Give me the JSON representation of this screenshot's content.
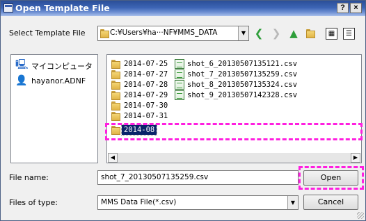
{
  "window": {
    "title": "Open Template File",
    "help_button": "?",
    "close_button": "×"
  },
  "toolbar": {
    "look_in_label": "Select Template File",
    "path": "C:¥Users¥ha···NF¥MMS_DATA"
  },
  "places": [
    {
      "label": "マイコンピュータ",
      "icon": "my-computer-icon"
    },
    {
      "label": "hayanor.ADNF",
      "icon": "user-folder-icon"
    }
  ],
  "folders": [
    "2014-07-25",
    "2014-07-27",
    "2014-07-28",
    "2014-07-29",
    "2014-07-30",
    "2014-07-31",
    "2014-08"
  ],
  "files": [
    "shot_6_20130507135121.csv",
    "shot_7_20130507135259.csv",
    "shot_8_20130507135324.csv",
    "shot_9_20130507142328.csv"
  ],
  "selected_folder": "2014-08",
  "form": {
    "file_name_label": "File name:",
    "file_name_value": "shot_7_20130507135259.csv",
    "file_type_label": "Files of type:",
    "file_type_value": "MMS Data File(*.csv)",
    "open_button": "Open",
    "cancel_button": "Cancel"
  },
  "highlight_color": "#ff1fe0"
}
